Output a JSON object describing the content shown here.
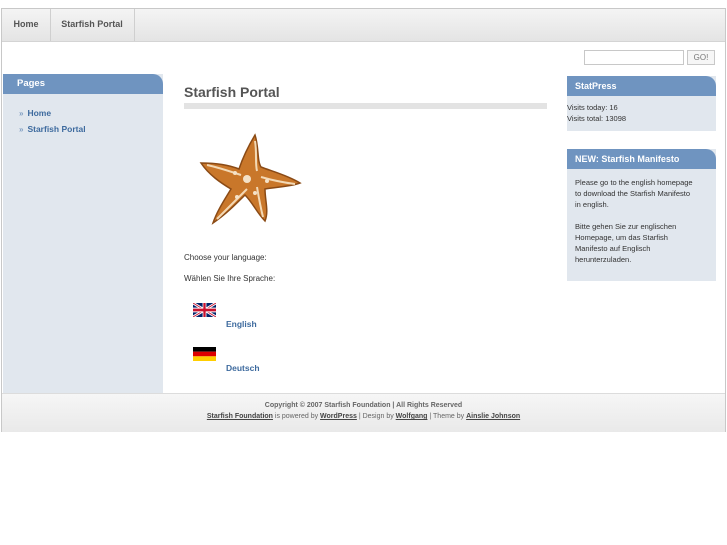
{
  "nav": {
    "home": "Home",
    "portal": "Starfish Portal"
  },
  "search": {
    "placeholder": "",
    "button": "GO!"
  },
  "sidebar": {
    "title": "Pages",
    "items": [
      {
        "label": "Home"
      },
      {
        "label": "Starfish Portal"
      }
    ]
  },
  "main": {
    "title": "Starfish Portal",
    "choose_en": "Choose your language:",
    "choose_de": "Wählen Sie Ihre Sprache:",
    "lang_en": "English",
    "lang_de": "Deutsch"
  },
  "statpress": {
    "title": "StatPress",
    "visits_today": "Visits today: 16",
    "visits_total": "Visits total: 13098"
  },
  "manifesto": {
    "title": "NEW: Starfish Manifesto",
    "text_en_1": "Please go to the english homepage",
    "text_en_2": "to download the Starfish Manifesto",
    "text_en_3": "in english.",
    "text_de_1": "Bitte gehen Sie zur englischen",
    "text_de_2": "Homepage, um das Starfish",
    "text_de_3": "Manifesto auf Englisch",
    "text_de_4": "herunterzuladen."
  },
  "footer": {
    "copyright": "Copyright © 2007 Starfish Foundation | All Rights Reserved",
    "site_link": "Starfish Foundation",
    "powered_text": " is powered by ",
    "wp_link": "WordPress",
    "design_text": " | Design by ",
    "designer_link": "Wolfgang",
    "theme_text": " | Theme by ",
    "theme_link": "Ainslie Johnson"
  },
  "colors": {
    "accent": "#6f94c0",
    "sidebar_bg": "#e1e7ee",
    "link": "#3d6a9e"
  }
}
